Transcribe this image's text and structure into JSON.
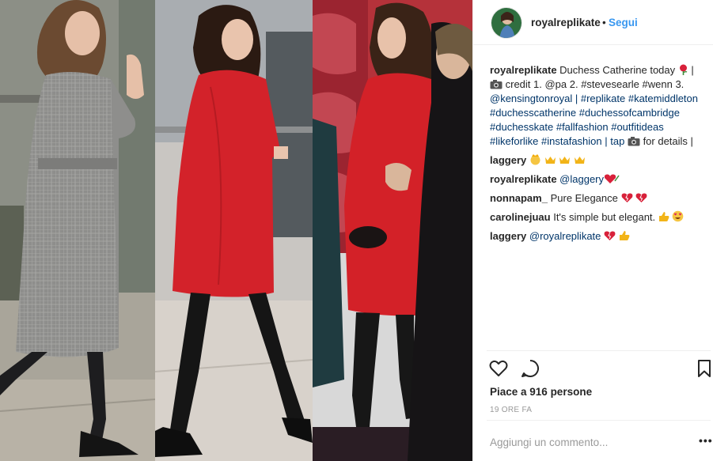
{
  "post": {
    "username": "royalreplikate",
    "separator": "•",
    "follow_label": "Segui",
    "caption": {
      "lines": [
        "Duchess Catherine today",
        "credit 1. @pa 2. #stevesearle #wenn 3.",
        "@kensingtonroyal | #replikate #katemiddleton",
        "#duchesscatherine #duchessofcambridge",
        "#duchesskate #fallfashion #outfitideas",
        "#likeforlike #instafashion | tap",
        "for details |"
      ],
      "pipe": "|"
    },
    "comments": [
      {
        "user": "laggery",
        "text": ""
      },
      {
        "user": "royalreplikate",
        "text": "@laggery"
      },
      {
        "user": "nonnapam_",
        "text": "Pure Elegance"
      },
      {
        "user": "carolinejuau",
        "text": "It's simple but elegant."
      },
      {
        "user": "laggery",
        "text": "@royalreplikate"
      }
    ],
    "likes": "Piace a 916 persone",
    "time_ago": "19 ORE FA",
    "add_comment_placeholder": "Aggiungi un commento...",
    "more_label": "•••",
    "icons": {
      "like": "heart-icon",
      "comment": "comment-bubble-icon",
      "save": "bookmark-icon",
      "camera": "camera-emoji-icon",
      "rose": "rose-emoji-icon"
    },
    "colors": {
      "link": "#3897f0",
      "hashtag": "#003569",
      "text": "#262626",
      "muted": "#999999",
      "heart": "#ed4956"
    }
  }
}
